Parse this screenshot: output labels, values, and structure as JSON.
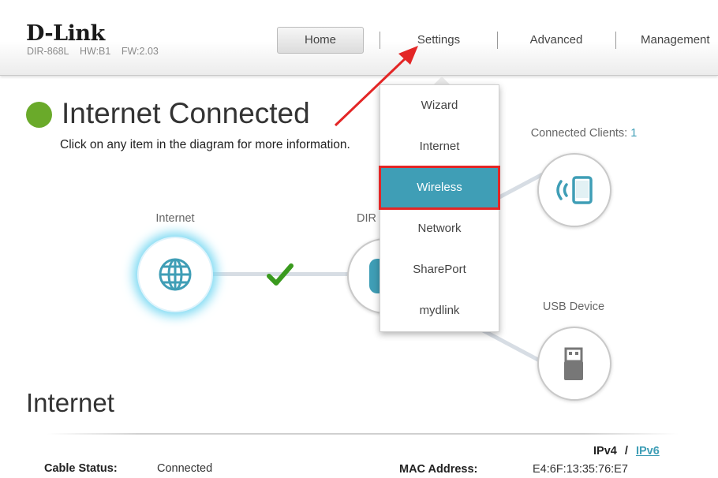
{
  "brand": {
    "logo": "D-Link",
    "model": "DIR-868L",
    "hw": "HW:B1",
    "fw": "FW:2.03"
  },
  "nav": {
    "home": "Home",
    "settings": "Settings",
    "advanced": "Advanced",
    "management": "Management"
  },
  "status": {
    "title": "Internet Connected",
    "subtitle": "Click on any item in the diagram for more information."
  },
  "diagram": {
    "internet_label": "Internet",
    "router_label": "DIR",
    "clients_label": "Connected Clients:",
    "clients_count": "1",
    "usb_label": "USB Device"
  },
  "settings_menu": {
    "items": [
      "Wizard",
      "Internet",
      "Wireless",
      "Network",
      "SharePort",
      "mydlink"
    ],
    "active": "Wireless"
  },
  "internet_section": {
    "title": "Internet",
    "ipv4": "IPv4",
    "separator": "/",
    "ipv6": "IPv6",
    "cable_status_label": "Cable Status:",
    "cable_status_value": "Connected",
    "mac_label": "MAC Address:",
    "mac_value": "E4:6F:13:35:76:E7"
  },
  "colors": {
    "accent": "#3f9eb6",
    "status_ok": "#6aaa2a",
    "highlight": "#e32626"
  }
}
